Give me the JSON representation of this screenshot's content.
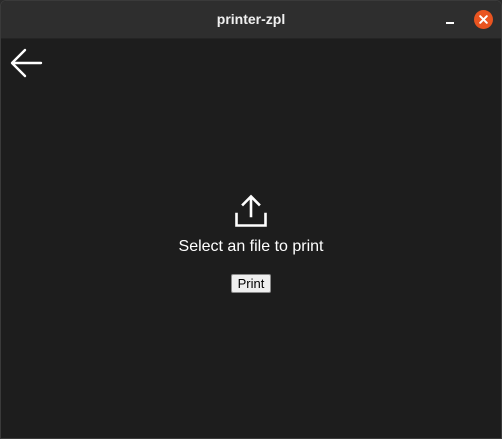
{
  "window": {
    "title": "printer-zpl"
  },
  "titlebar_buttons": {
    "minimize_icon": "minimize-icon",
    "close_icon": "close-icon",
    "close_color": "#e95420"
  },
  "main": {
    "back_icon": "arrow-left-icon",
    "upload_icon": "upload-icon",
    "prompt": "Select an file to print",
    "print_label": "Print"
  },
  "colors": {
    "background": "#1d1d1d",
    "titlebar": "#2e2e2e",
    "text": "#ffffff"
  }
}
